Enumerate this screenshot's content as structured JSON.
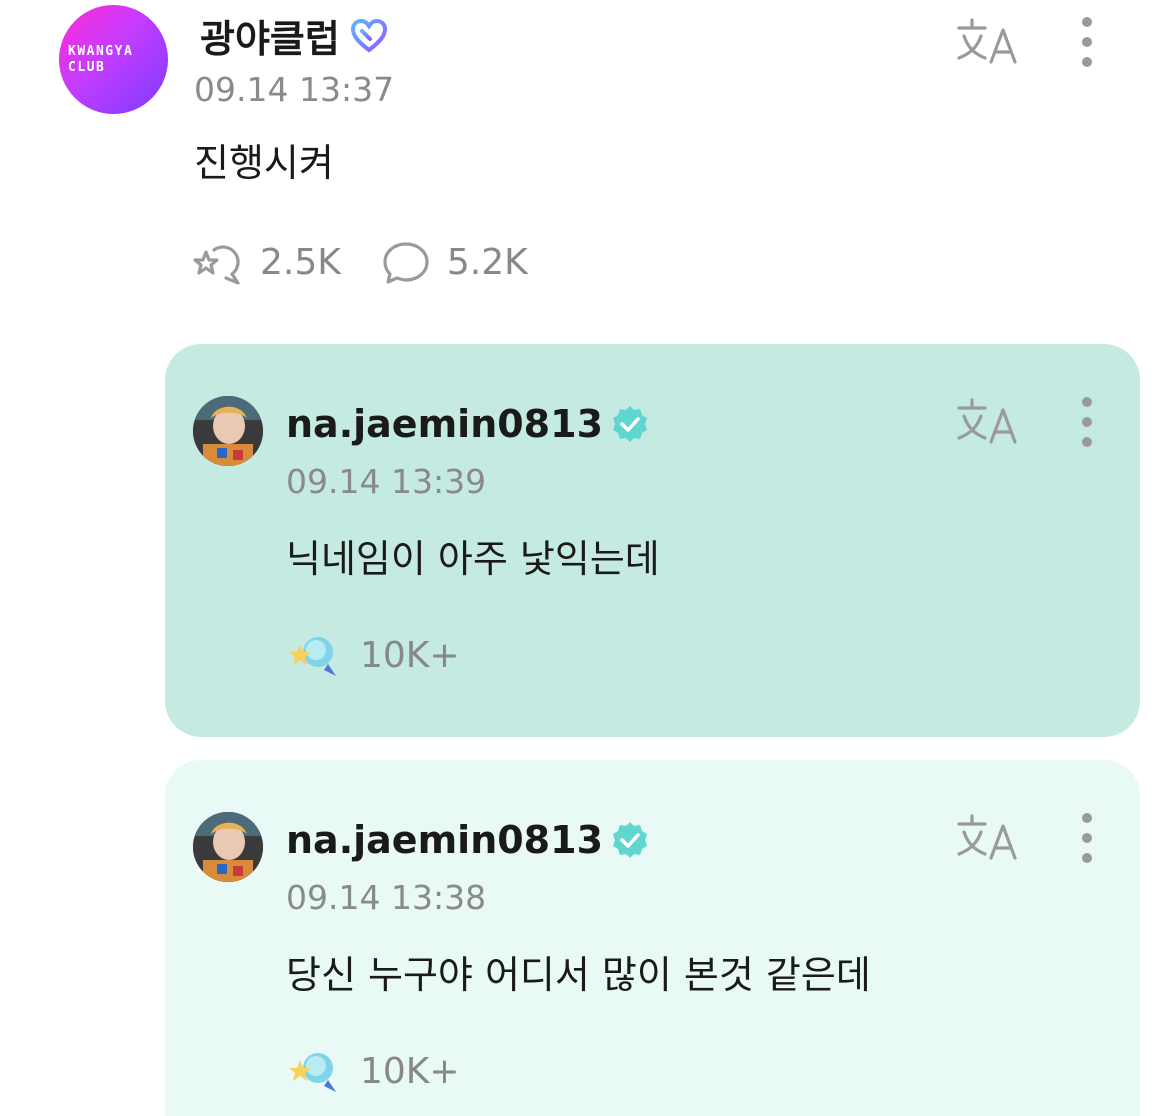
{
  "post": {
    "avatar": {
      "line1": "KWANGYA",
      "line2": "CLUB"
    },
    "author": "광야클럽",
    "badge_icon": "heart-badge-icon",
    "timestamp": "09.14 13:37",
    "body": "진행시켜",
    "likes": "2.5K",
    "comments": "5.2K"
  },
  "comments": [
    {
      "author": "na.jaemin0813",
      "timestamp": "09.14 13:39",
      "body": "닉네임이 아주 낯익는데",
      "reactions": "10K+",
      "background": "#c5eae2"
    },
    {
      "author": "na.jaemin0813",
      "timestamp": "09.14 13:38",
      "body": "당신 누구야 어디서 많이 본것 같은데",
      "reactions": "10K+",
      "background": "#e9f9f5"
    }
  ],
  "colors": {
    "verified": "#5fd6d0",
    "muted_text": "#8a8a8a",
    "icon_gray": "#9a9a9a"
  }
}
